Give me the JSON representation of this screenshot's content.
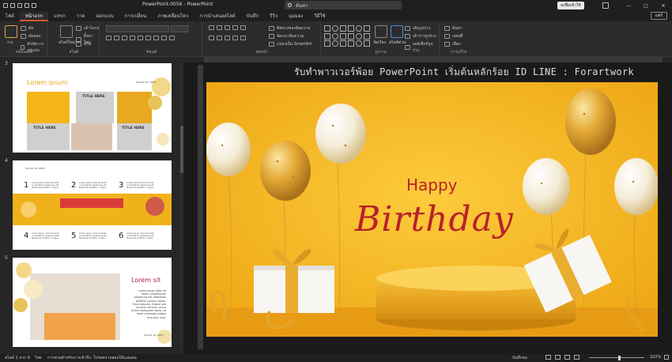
{
  "titlebar": {
    "title": "PowerPoint-0056 - PowerPoint",
    "search_placeholder": "ค้นหา",
    "signin_label": "ลงชื่อเข้าใช้",
    "minimize": "—",
    "maximize": "□",
    "close": "✕"
  },
  "tabs": [
    "ไฟล์",
    "หน้าแรก",
    "แทรก",
    "วาด",
    "ออกแบบ",
    "การเปลี่ยน",
    "ภาพเคลื่อนไหว",
    "การนำเสนอสไลด์",
    "บันทึก",
    "รีวิว",
    "มุมมอง",
    "วิธีใช้"
  ],
  "share_label": "แชร์",
  "ribbon": {
    "paste_label": "วาง",
    "cut_label": "ตัด",
    "copy_label": "คัดลอก",
    "format_painter_label": "ตัวคัดวางรูปแบบ",
    "clipboard_group": "คลิปบอร์ด",
    "new_slide_label": "สไลด์ใหม่",
    "layout_label": "เค้าโครง",
    "reset_label": "ตั้งค่าใหม่",
    "section_label": "ส่วน",
    "slides_group": "สไลด์",
    "font_group": "ฟอนต์",
    "text_direction_label": "ทิศทางของข้อความ",
    "align_text_label": "จัดแนวข้อความ",
    "smartart_label": "แปลงเป็น SmartArt",
    "paragraph_group": "ย่อหน้า",
    "arrange_label": "จัดเรียง",
    "quick_styles_label": "สไตล์ด่วน",
    "shape_fill_label": "เติมรูปร่าง",
    "shape_outline_label": "เค้าร่างรูปร่าง",
    "shape_effects_label": "เอฟเฟ็กต์รูปร่าง",
    "drawing_group": "รูปวาด",
    "find_label": "ค้นหา",
    "replace_label": "แทนที่",
    "select_label": "เลือก",
    "editing_group": "การแก้ไข"
  },
  "thumbnails": {
    "numbers": [
      "3",
      "4",
      "5"
    ],
    "s3": {
      "heading": "Lorem ipsum",
      "title_here": "TITLE HERE",
      "small": "SOLOR SIT AMET"
    },
    "s4": {
      "small": "SOLOR SIT AMET",
      "nums": [
        "1",
        "2",
        "3",
        "4",
        "5",
        "6"
      ],
      "line": "Lorem ipsum dolor sit amet, consectetuer adipiscing elit. Maecenas porttitor congue."
    },
    "s5": {
      "heading": "Lorem sit",
      "body": "Lorem ipsum dolor sit amet, consectetuer adipiscing elit. Maecenas porttitor congue massa. Fusce posuere, magna sed pulvinar ultricies, purus lectus malesuada libero, sit amet commodo magna eros quis urna.",
      "small": "SOLOR SIT AMET"
    }
  },
  "watermark": "รับทำพาวเวอร์พ้อย PowerPoint เริ่มต้นหลักร้อย ID LINE : Forartwork",
  "slide": {
    "happy": "Happy",
    "birthday": "Birthday"
  },
  "status": {
    "slide_count": "สไลด์ 1 จาก 9",
    "language": "ไทย",
    "accessibility": "การช่วยสำหรับการเข้าถึง: โปรดตรวจสอบให้แน่นอน",
    "notes": "บันทึกย่อ",
    "zoom": "102%"
  },
  "colors": {
    "accent": "#d35230",
    "slide_bg": "#f4b71c",
    "birthday_text": "#b8202a",
    "gold": "#e0a326"
  }
}
